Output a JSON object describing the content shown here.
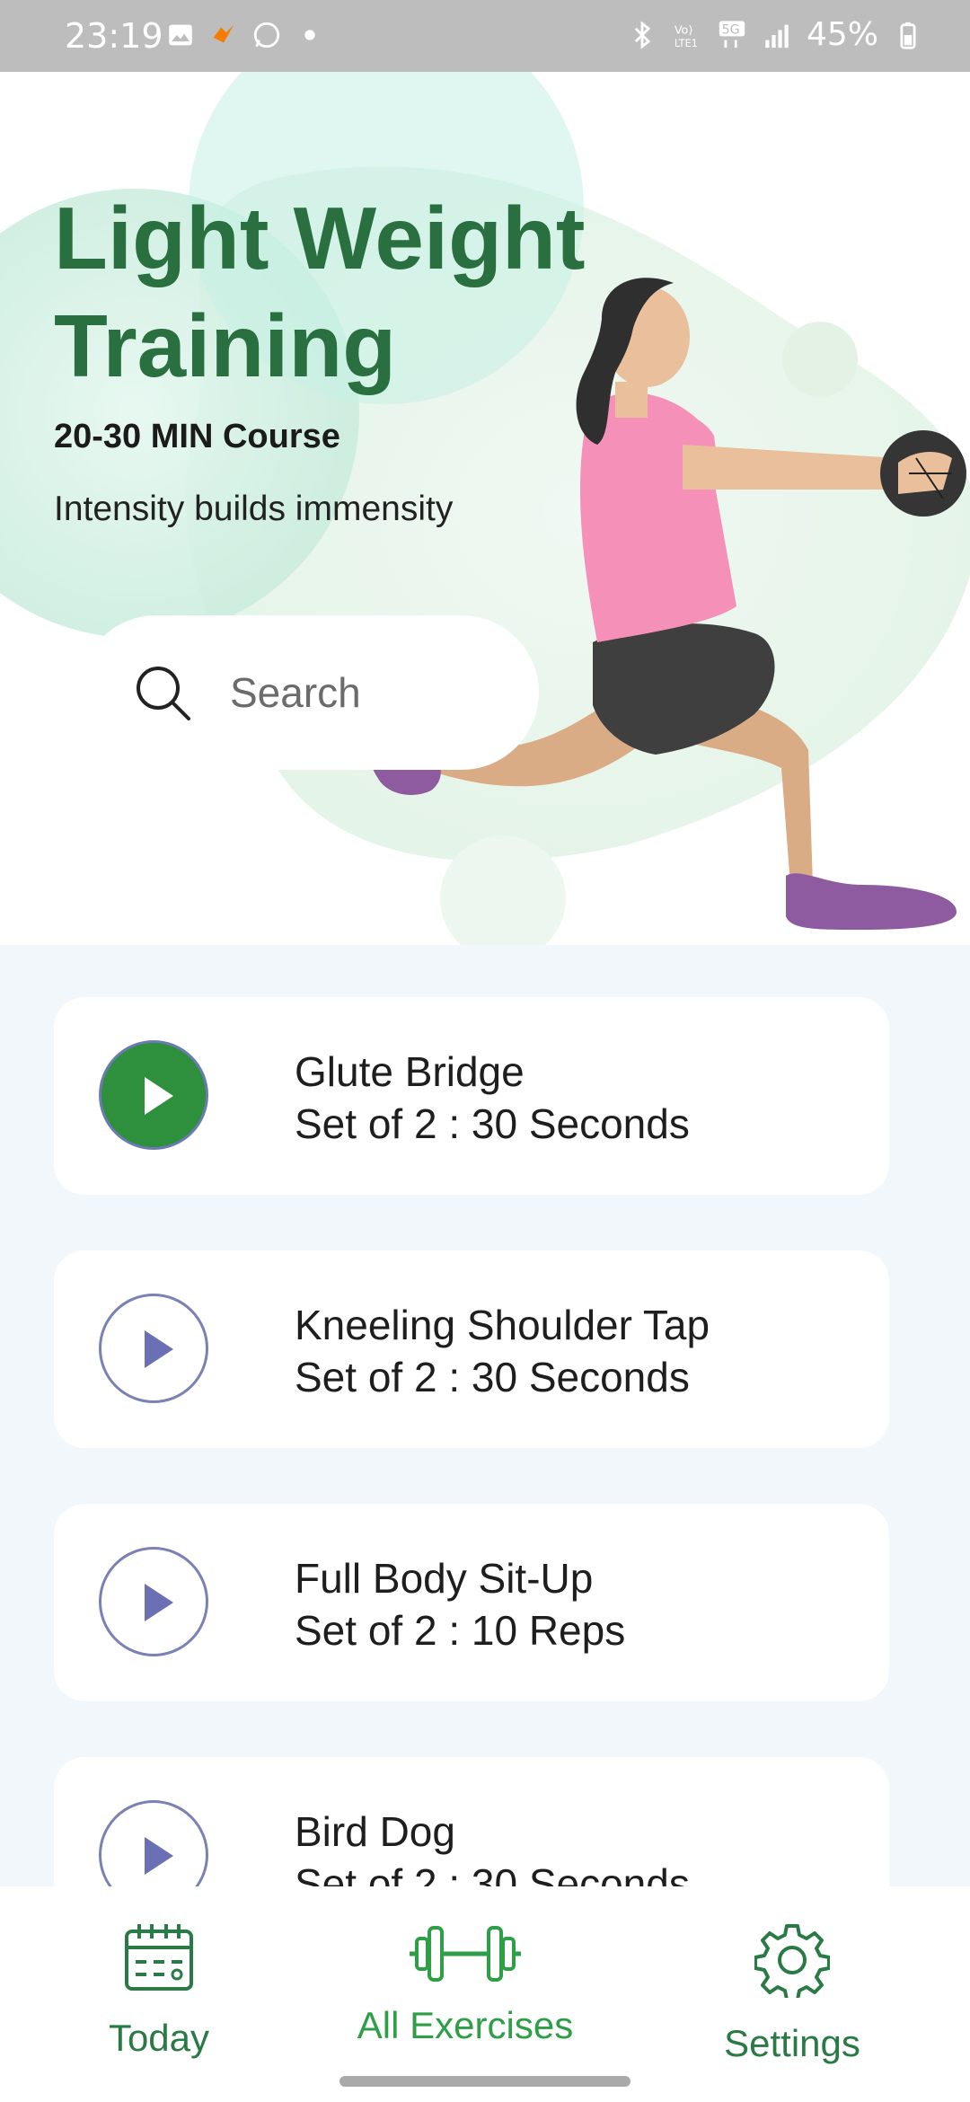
{
  "status_bar": {
    "time": "23:19",
    "battery": "45%",
    "left_icons": [
      "gallery-icon",
      "app-icon",
      "whatsapp-icon",
      "dot-icon"
    ],
    "right_icons": [
      "bluetooth-icon",
      "volte-icon",
      "5g-icon",
      "signal-icon",
      "battery-icon"
    ]
  },
  "hero": {
    "title": "Light Weight Training",
    "course": "20-30 MIN Course",
    "tagline": "Intensity builds immensity",
    "search_placeholder": "Search"
  },
  "exercises": [
    {
      "name": "Glute Bridge",
      "detail": "Set of 2 : 30 Seconds",
      "active": true
    },
    {
      "name": "Kneeling Shoulder Tap",
      "detail": "Set of 2 : 30 Seconds",
      "active": false
    },
    {
      "name": "Full Body Sit-Up",
      "detail": "Set of 2 : 10 Reps",
      "active": false
    },
    {
      "name": "Bird Dog",
      "detail": "Set of 2 : 30 Seconds",
      "active": false
    }
  ],
  "nav": {
    "today": "Today",
    "all_exercises": "All Exercises",
    "settings": "Settings"
  },
  "colors": {
    "accent_green": "#2a6f3f",
    "play_active": "#2e8f3c",
    "play_outline": "#7b80b5",
    "list_bg": "#f2f7fc"
  }
}
